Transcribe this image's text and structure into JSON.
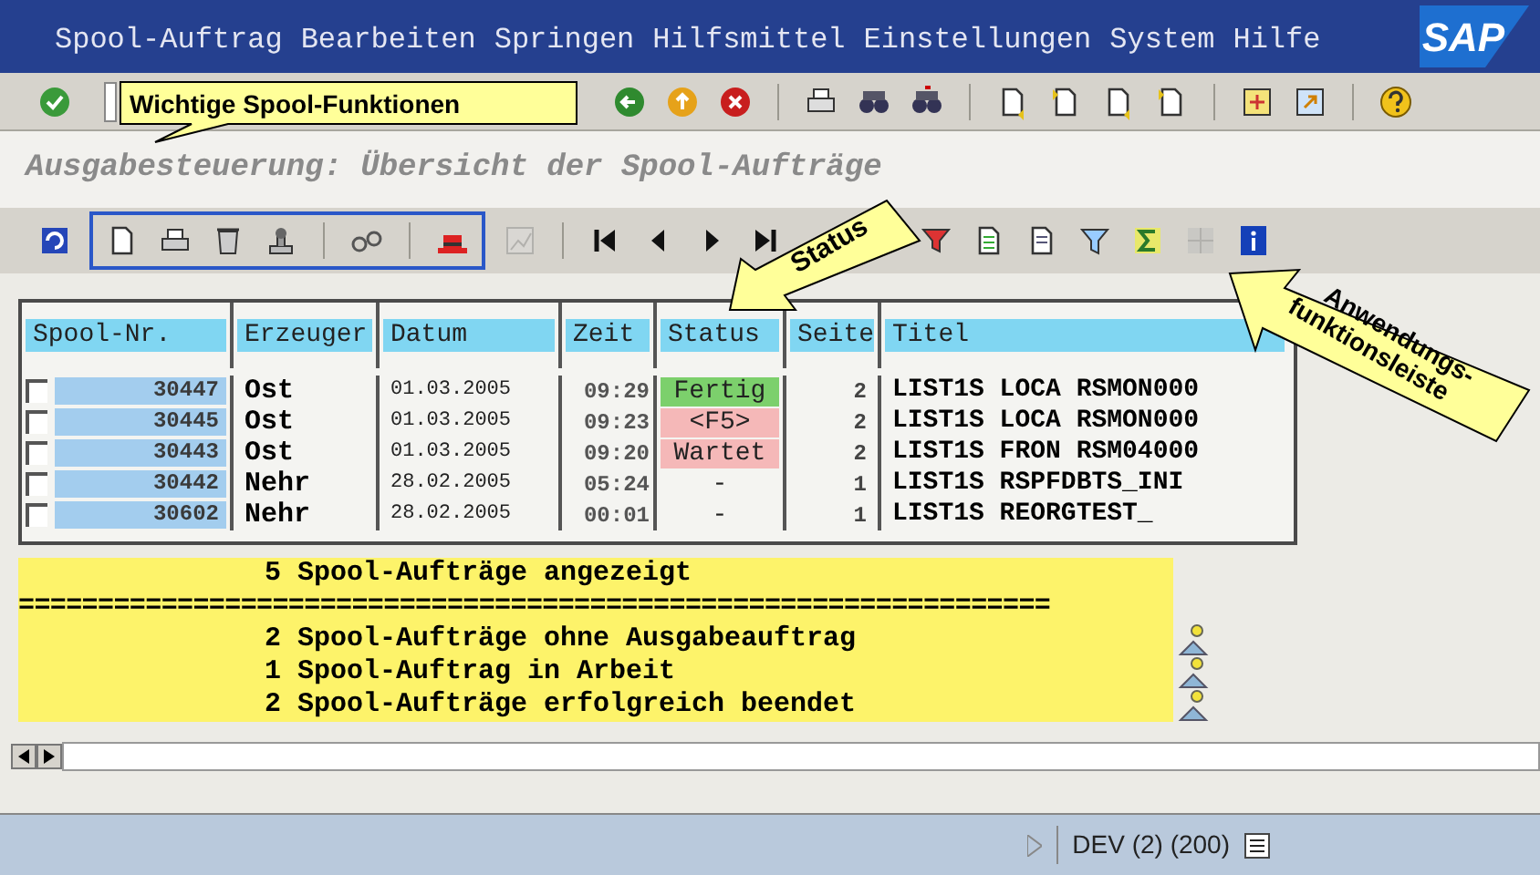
{
  "menu": [
    "Spool-Auftrag",
    "Bearbeiten",
    "Springen",
    "Hilfsmittel",
    "Einstellungen",
    "System",
    "Hilfe"
  ],
  "logo": "SAP",
  "screen_title": "Ausgabesteuerung: Übersicht der Spool-Aufträge",
  "table": {
    "columns": [
      "Spool-Nr.",
      "Erzeuger",
      "Datum",
      "Zeit",
      "Status",
      "Seite",
      "Titel"
    ],
    "rows": [
      {
        "checked": false,
        "spool_nr": "30447",
        "erzeuger": "Ost",
        "datum": "01.03.2005",
        "zeit": "09:29",
        "status": "Fertig",
        "color": "#7cd06c",
        "seite": "2",
        "titel": "LIST1S LOCA RSMON000"
      },
      {
        "checked": false,
        "spool_nr": "30445",
        "erzeuger": "Ost",
        "datum": "01.03.2005",
        "zeit": "09:23",
        "status": "<F5>",
        "color": "#f5b8b8",
        "seite": "2",
        "titel": "LIST1S LOCA RSMON000"
      },
      {
        "checked": false,
        "spool_nr": "30443",
        "erzeuger": "Ost",
        "datum": "01.03.2005",
        "zeit": "09:20",
        "status": "Wartet",
        "color": "#f5b8b8",
        "seite": "2",
        "titel": "LIST1S FRON RSM04000"
      },
      {
        "checked": false,
        "spool_nr": "30442",
        "erzeuger": "Nehr",
        "datum": "28.02.2005",
        "zeit": "05:24",
        "status": "-",
        "seite": "1",
        "titel": "LIST1S RSPFDBTS_INI"
      },
      {
        "checked": false,
        "spool_nr": "30602",
        "erzeuger": "Nehr",
        "datum": "28.02.2005",
        "zeit": "00:01",
        "status": "-",
        "seite": "1",
        "titel": "LIST1S REORGTEST_"
      }
    ]
  },
  "summary": [
    {
      "kind": "header",
      "text": "5 Spool-Aufträge angezeigt"
    },
    {
      "kind": "separator",
      "text": "================================================================="
    },
    {
      "kind": "count",
      "text": "2 Spool-Aufträge ohne Ausgabeauftrag"
    },
    {
      "kind": "count",
      "text": "1 Spool-Auftrag in Arbeit"
    },
    {
      "kind": "count",
      "text": "2 Spool-Aufträge erfolgreich beendet"
    }
  ],
  "status_bar": {
    "system": "DEV (2) (200)"
  },
  "callouts": {
    "functions": "Wichtige Spool-Funktionen",
    "status": "Status",
    "app_toolbar": [
      "Anwendungs-",
      "funktionsleiste"
    ]
  }
}
